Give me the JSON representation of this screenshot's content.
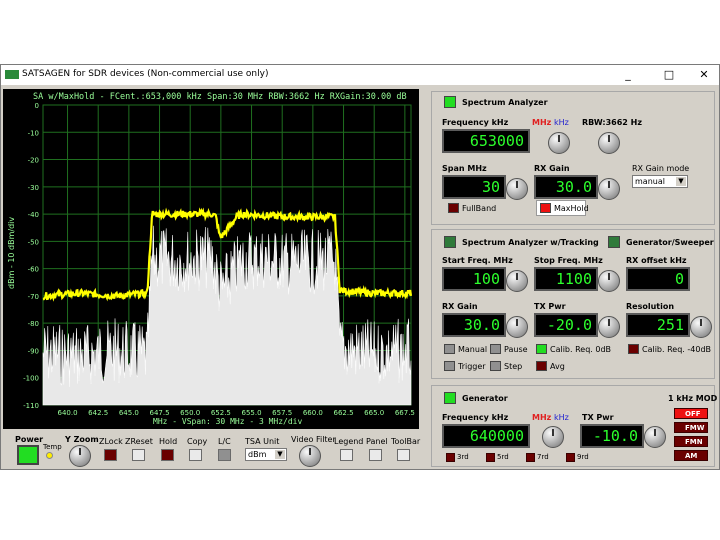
{
  "window": {
    "title": "SATSAGEN for SDR devices (Non-commercial use only)",
    "minimize": "_",
    "maximize": "□",
    "close": "✕"
  },
  "plot": {
    "header": "SA w/MaxHold - FCent.:653,000 kHz Span:30 MHz RBW:3662 Hz RXGain:30.00 dB",
    "ylabel": "dBm - 10 dBm/div",
    "footer": "MHz - VSpan: 30 MHz - 3 MHz/div",
    "y_ticks": [
      "0",
      "-10",
      "-20",
      "-30",
      "-40",
      "-50",
      "-60",
      "-70",
      "-80",
      "-90",
      "-100",
      "-110"
    ],
    "x_ticks": [
      "640.0",
      "642.5",
      "645.0",
      "647.5",
      "650.0",
      "652.5",
      "655.0",
      "657.5",
      "660.0",
      "662.5",
      "665.0",
      "667.5"
    ]
  },
  "chart_data": {
    "type": "line",
    "title": "SA w/MaxHold - FCent.:653,000 kHz Span:30 MHz RBW:3662 Hz RXGain:30.00 dB",
    "xlabel": "MHz - VSpan: 30 MHz - 3 MHz/div",
    "ylabel": "dBm - 10 dBm/div",
    "xlim": [
      638,
      668
    ],
    "ylim": [
      -110,
      0
    ],
    "grid": true,
    "series": [
      {
        "name": "",
        "color": "#ffff00",
        "x": [
          638,
          641,
          644,
          646.5,
          646.9,
          651.8,
          652.1,
          652.4,
          652.6,
          653.8,
          654.2,
          658,
          661.8,
          662.2,
          665,
          668
        ],
        "y": [
          -70,
          -69,
          -70,
          -69,
          -40,
          -40,
          -41,
          -48,
          -48,
          -41,
          -40,
          -41,
          -41,
          -68,
          -69,
          -69
        ]
      },
      {
        "name": "",
        "color": "#ffffff",
        "x": [
          638,
          641,
          644,
          646.5,
          646.9,
          649,
          651.8,
          652.4,
          652.6,
          654.2,
          656,
          658,
          661.8,
          662.2,
          665,
          668
        ],
        "y": [
          -79,
          -80,
          -78,
          -80,
          -44,
          -45,
          -44,
          -55,
          -56,
          -45,
          -44,
          -46,
          -45,
          -77,
          -79,
          -78
        ]
      }
    ]
  },
  "bottom": {
    "power": "Power",
    "yzoom": "Y Zoom",
    "temp": "Temp",
    "zlock": "ZLock",
    "zreset": "ZReset",
    "hold": "Hold",
    "copy": "Copy",
    "lc": "L/C",
    "tsa_unit": "TSA Unit",
    "tsa_unit_value": "dBm",
    "video_filter": "Video Filter",
    "legend": "Legend",
    "panel": "Panel",
    "toolbar": "ToolBar"
  },
  "sa": {
    "header": "Spectrum Analyzer",
    "freq_label": "Frequency kHz",
    "unit_mhz": "MHz",
    "unit_khz": "kHz",
    "rbw": "RBW:3662 Hz",
    "freq_value": "653000",
    "span_label": "Span MHz",
    "span_value": "30",
    "rxgain_label": "RX Gain",
    "rxgain_value": "30.0",
    "rxgain_mode_label": "RX Gain mode",
    "rxgain_mode_value": "manual",
    "fullband": "FullBand",
    "maxhold": "MaxHold"
  },
  "tracking": {
    "header": "Spectrum Analyzer w/Tracking",
    "gen_header": "Generator/Sweeper",
    "start_label": "Start Freq. MHz",
    "start_value": "100",
    "stop_label": "Stop Freq. MHz",
    "stop_value": "1100",
    "rxoffset_label": "RX offset kHz",
    "rxoffset_value": "0",
    "rxgain_label": "RX Gain",
    "rxgain_value": "30.0",
    "txpwr_label": "TX Pwr",
    "txpwr_value": "-20.0",
    "resolution_label": "Resolution",
    "resolution_value": "251",
    "manual": "Manual",
    "pause": "Pause",
    "calib0": "Calib. Req. 0dB",
    "calib40": "Calib. Req. -40dB",
    "trigger": "Trigger",
    "step": "Step",
    "avg": "Avg"
  },
  "generator": {
    "header": "Generator",
    "mod_title": "1 kHz MOD",
    "freq_label": "Frequency kHz",
    "unit_mhz": "MHz",
    "unit_khz": "kHz",
    "freq_value": "640000",
    "txpwr_label": "TX Pwr",
    "txpwr_value": "-10.0",
    "mod_off": "OFF",
    "mod_fmw": "FMW",
    "mod_fmn": "FMN",
    "mod_am": "AM",
    "h3": "3rd",
    "h5": "5rd",
    "h7": "7rd",
    "h9": "9rd"
  }
}
